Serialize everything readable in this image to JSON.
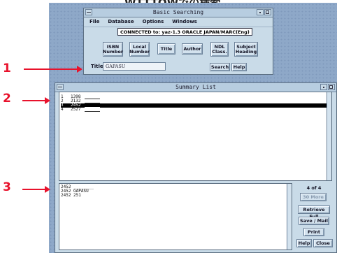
{
  "page": {
    "title": "WTTTOWでの検索"
  },
  "search_window": {
    "title": "Basic Searching",
    "menus": [
      "File",
      "Database",
      "Options",
      "Windows"
    ],
    "connection": "CONNECTED to: yaz-1.3 ORACLE JAPAN/MARC(Eng)",
    "buttons": {
      "isbn": "ISBN\nNumber",
      "local": "Local\nNumber",
      "title": "Title",
      "author": "Author",
      "ndl": "NDL\nClass.",
      "subject": "Subject\nHeading"
    },
    "title_label": "Title",
    "title_value": "GAPASU",
    "search": "Search",
    "help": "Help"
  },
  "summary_window": {
    "title": "Summary List",
    "rows": [
      {
        "n": "1",
        "v": "1398",
        "selected": false
      },
      {
        "n": "2",
        "v": "2132",
        "selected": false
      },
      {
        "n": "3",
        "v": "2452",
        "selected": true
      },
      {
        "n": "4",
        "v": "2527",
        "selected": false
      }
    ],
    "detail_lines": [
      "2452 ________",
      "2452 GAPASU",
      "2452 251"
    ],
    "count": "4 of 4",
    "more": "30 More",
    "retrieve": "Retrieve Full",
    "save": "Save / Mail",
    "print": "Print",
    "help": "Help",
    "close": "Close"
  },
  "annotations": [
    "1",
    "2",
    "3"
  ],
  "colors": {
    "accent": "#e8122c",
    "window": "#c9dbe8",
    "desktop": "#8ea8c8"
  }
}
